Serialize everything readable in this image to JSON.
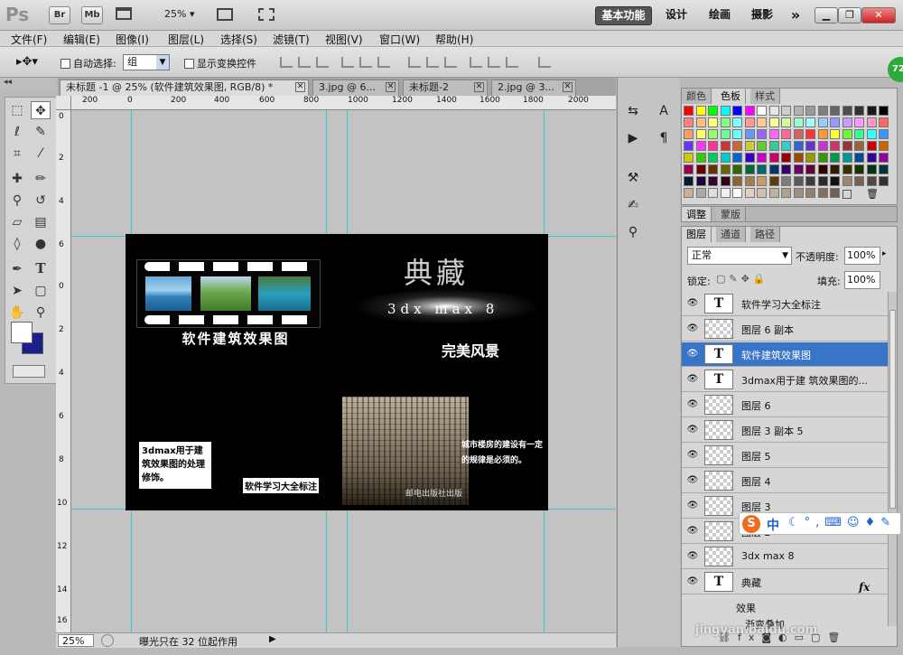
{
  "appbar": {
    "logo": "Ps",
    "br": "Br",
    "mb": "Mb",
    "zoom": "25%",
    "workspaces": [
      "基本功能",
      "设计",
      "绘画",
      "摄影"
    ],
    "more": "»",
    "window_controls": [
      "▁",
      "❐",
      "✕"
    ]
  },
  "menu": [
    "文件(F)",
    "编辑(E)",
    "图像(I)",
    "图层(L)",
    "选择(S)",
    "滤镜(T)",
    "视图(V)",
    "窗口(W)",
    "帮助(H)"
  ],
  "options": {
    "auto_select_label": "自动选择:",
    "auto_select_value": "组",
    "show_transform_label": "显示变换控件"
  },
  "tabs": [
    {
      "label": "未标题 -1 @ 25% (软件建筑效果图, RGB/8) *",
      "close": "✕"
    },
    {
      "label": "3.jpg @ 6...",
      "close": "✕"
    },
    {
      "label": "未标题-2",
      "close": "✕"
    },
    {
      "label": "2.jpg @ 3...",
      "close": "✕"
    }
  ],
  "hruler": [
    "200",
    "0",
    "200",
    "400",
    "600",
    "800",
    "1000",
    "1200",
    "1400",
    "1600",
    "1800",
    "2000"
  ],
  "vruler": [
    "0",
    "2",
    "4",
    "6",
    "0",
    "2",
    "4",
    "6",
    "8",
    "10",
    "12",
    "14",
    "16"
  ],
  "document": {
    "cover_title": "典藏",
    "cover_sub": "3dx max 8",
    "cover_tag": "完美风景",
    "spine_title": "软件建筑效果图",
    "back_desc": "3dmax用于建筑效果图的处理修饰。",
    "back_label": "软件学习大全标注",
    "cover_blurb": "城市楼房的建设有一定的规律是必须的。",
    "publisher": "邮电出版社出版"
  },
  "status": {
    "zoom": "25%",
    "text": "曝光只在 32 位起作用",
    "arrow": "▶"
  },
  "swatch_panel": {
    "tabs": [
      "颜色",
      "色板",
      "样式"
    ],
    "colors": [
      "#ff0000",
      "#ffff00",
      "#00ff00",
      "#00ffff",
      "#0000ff",
      "#ff00ff",
      "#ffffff",
      "#e6e6e6",
      "#cccccc",
      "#b3b3b3",
      "#999999",
      "#808080",
      "#666666",
      "#4d4d4d",
      "#333333",
      "#1a1a1a",
      "#000000",
      "#ff8080",
      "#ffbf80",
      "#ffff80",
      "#80ff80",
      "#80ffff",
      "#ff9999",
      "#ffcc99",
      "#ffff99",
      "#ccff99",
      "#99ffcc",
      "#99ffff",
      "#99ccff",
      "#9999ff",
      "#cc99ff",
      "#ff99ff",
      "#ff99cc",
      "#ff6666",
      "#ff9966",
      "#ffff66",
      "#99ff66",
      "#66ff99",
      "#66ffff",
      "#6699ff",
      "#9966ff",
      "#ff66ff",
      "#ff6699",
      "#cc6666",
      "#ff3333",
      "#ff9933",
      "#ffff33",
      "#66ff33",
      "#33ff99",
      "#33ffff",
      "#3399ff",
      "#6633ff",
      "#ff33ff",
      "#ff3399",
      "#cc3333",
      "#cc6633",
      "#cccc33",
      "#66cc33",
      "#33cc99",
      "#33cccc",
      "#3366cc",
      "#6633cc",
      "#cc33cc",
      "#cc3366",
      "#993333",
      "#996633",
      "#cc0000",
      "#cc6600",
      "#cccc00",
      "#33cc00",
      "#00cc66",
      "#00cccc",
      "#0066cc",
      "#3300cc",
      "#cc00cc",
      "#cc0066",
      "#990000",
      "#994c00",
      "#999900",
      "#339900",
      "#00994c",
      "#009999",
      "#004c99",
      "#330099",
      "#990099",
      "#99004c",
      "#660000",
      "#663300",
      "#666600",
      "#336600",
      "#006633",
      "#006666",
      "#003366",
      "#330066",
      "#660066",
      "#660033",
      "#330000",
      "#331a00",
      "#333300",
      "#1a3300",
      "#00331a",
      "#003333",
      "#001a33",
      "#1a0033",
      "#330033",
      "#33001a",
      "#8c6239",
      "#a67c52",
      "#c69c6d",
      "#603913",
      "#7d7d7d",
      "#5a5a5a",
      "#3c3c3c",
      "#2a2a2a",
      "#111111",
      "#998675",
      "#736357",
      "#534741",
      "#362f2d",
      "#c7b299",
      "#aaaaaa",
      "#dddddd",
      "#f0f0f0",
      "#fafafa",
      "#e0d0c0",
      "#d0c0b0",
      "#c0b0a0",
      "#b0a090",
      "#a09080",
      "#908070",
      "#807060",
      "#706050"
    ]
  },
  "adjust_tabs": [
    "调整",
    "蒙版"
  ],
  "layers_panel": {
    "tabs": [
      "图层",
      "通道",
      "路径"
    ],
    "blend": "正常",
    "opacity_label": "不透明度:",
    "opacity": "100%",
    "lock_label": "锁定:",
    "fill_label": "填充:",
    "fill": "100%",
    "layers": [
      {
        "name": "软件学习大全标注",
        "type": "T"
      },
      {
        "name": "图层 6 副本",
        "type": "px"
      },
      {
        "name": "软件建筑效果图",
        "type": "T"
      },
      {
        "name": "3dmax用于建 筑效果图的...",
        "type": "T"
      },
      {
        "name": "图层 6",
        "type": "px"
      },
      {
        "name": "图层 3 副本 5",
        "type": "px"
      },
      {
        "name": "图层 5",
        "type": "px"
      },
      {
        "name": "图层 4",
        "type": "px"
      },
      {
        "name": "图层 3",
        "type": "px"
      },
      {
        "name": "图层 2",
        "type": "px"
      },
      {
        "name": "3dx max 8",
        "type": "px"
      },
      {
        "name": "典藏",
        "type": "T"
      }
    ],
    "effects": "效果",
    "effect_item": "渐变叠加",
    "fx": "fx"
  },
  "ime": {
    "logo": "S",
    "lang": "中"
  },
  "watermark": "jingyan.baidu.com",
  "badge": "72"
}
